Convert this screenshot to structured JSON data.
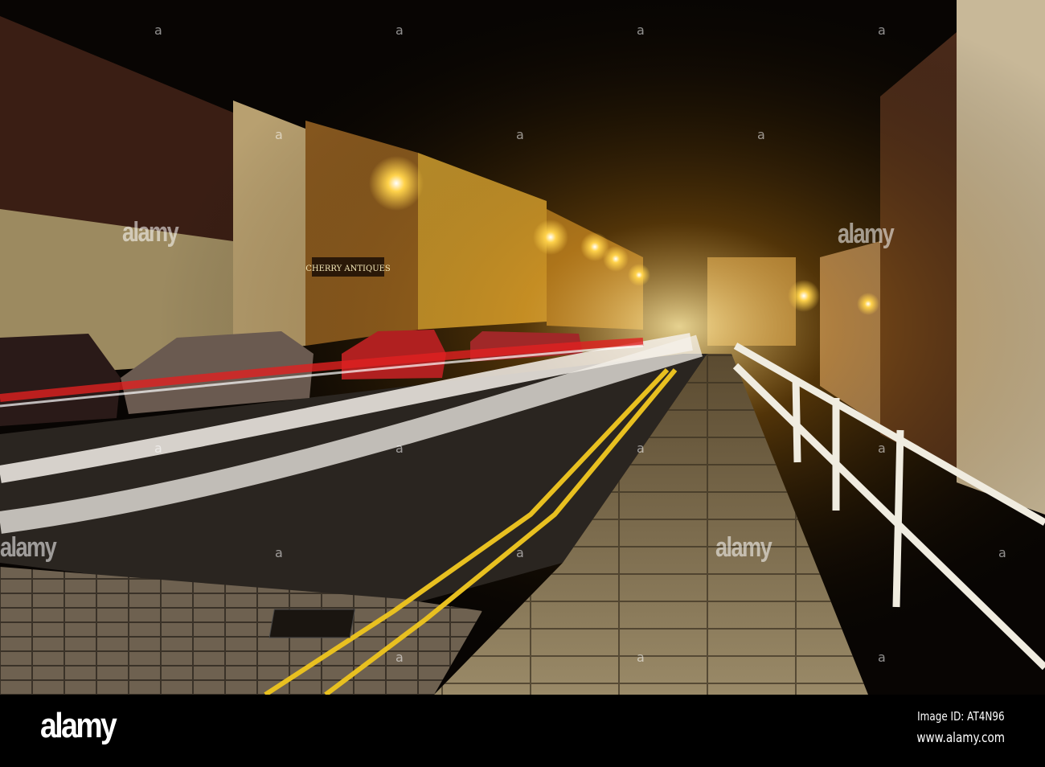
{
  "photo": {
    "subject": "Night street with light trails",
    "shop_sign": "CHERRY ANTIQUES",
    "watermark_text": "alamy",
    "watermark_mark": "a",
    "colors": {
      "sky": "#0a0604",
      "lamp": "#ffd24a",
      "road": "#2a2520",
      "pavement": "#8a7a5a",
      "trail_red": "#e02020",
      "trail_white": "#f4f0ea",
      "yellow_line": "#e8c020"
    }
  },
  "footer": {
    "logo": "alamy",
    "image_id": "Image ID: AT4N96",
    "website": "www.alamy.com"
  }
}
